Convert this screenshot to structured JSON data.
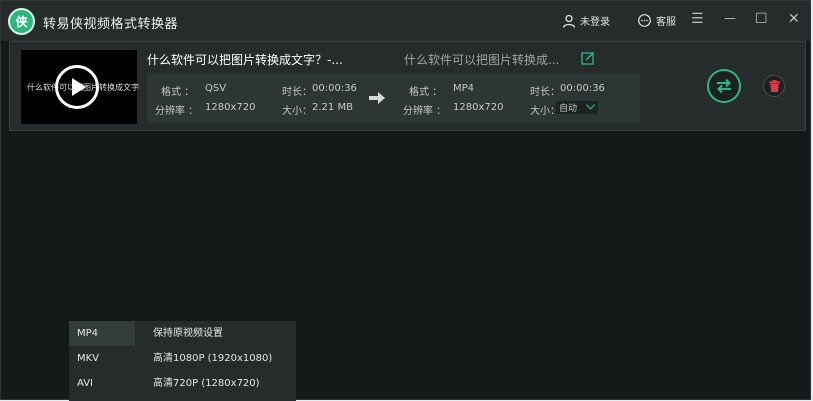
{
  "app": {
    "title": "转易侠视频格式转换器",
    "logo_char": "侠",
    "login_label": "未登录",
    "service_label": "客服",
    "accent": "#2fb67e"
  },
  "window_controls": {
    "menu": "☰",
    "minimize": "—",
    "maximize": "☐",
    "close": "✕"
  },
  "file": {
    "source_name": "什么软件可以把图片转换成文字？-...",
    "output_name": "什么软件可以把图片转换成...",
    "thumb_text": "什么软件可以把图片转换成文字",
    "source": {
      "format_label": "格式 ：",
      "format": "QSV",
      "duration_label": "时长：",
      "duration": "00:00:36",
      "resolution_label": "分辨率 ：",
      "resolution": "1280x720",
      "size_label": "大小：",
      "size": "2.21 MB"
    },
    "target": {
      "format_label": "格式 ：",
      "format": "MP4",
      "duration_label": "时长：",
      "duration": "00:00:36",
      "resolution_label": "分辨率 ：",
      "resolution": "1280x720",
      "size_label": "大小：",
      "size_value": "自动"
    }
  },
  "icons": {
    "user": "user-icon",
    "chat": "chat-icon",
    "edit": "edit-icon",
    "arrow": "arrow-right-icon",
    "convert": "convert-icon",
    "delete": "trash-icon",
    "play": "play-icon"
  },
  "format_menu": {
    "formats": [
      "MP4",
      "MKV",
      "AVI"
    ],
    "selected_format": "MP4",
    "options": [
      "保持原视频设置",
      "高清1080P (1920x1080)",
      "高清720P (1280x720)"
    ]
  }
}
